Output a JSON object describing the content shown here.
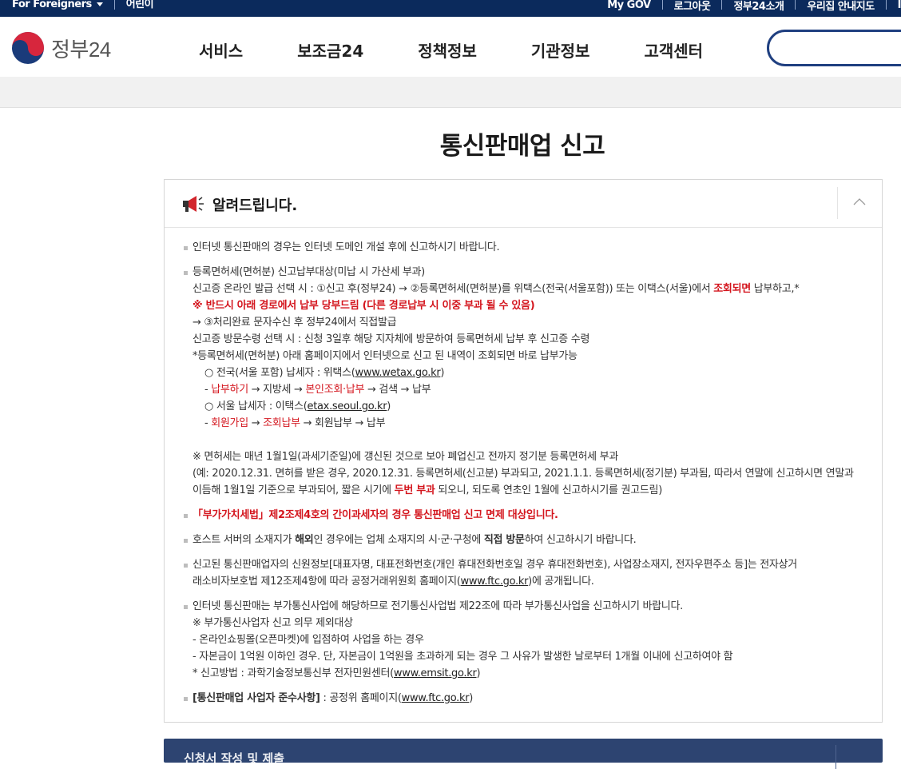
{
  "topbar": {
    "left": [
      "For Foreigners",
      "어린이"
    ],
    "right": [
      "My GOV",
      "로그아웃",
      "정부24소개",
      "우리집 안내지도",
      "I"
    ]
  },
  "header": {
    "logo_text": "정부24",
    "nav": [
      "서비스",
      "보조금24",
      "정책정보",
      "기관정보",
      "고객센터"
    ],
    "search_placeholder": ""
  },
  "page": {
    "title": "통신판매업 신고"
  },
  "notice": {
    "title": "알려드립니다.",
    "items": {
      "i1": "인터넷 통신판매의 경우는 인터넷 도메인 개설 후에 신고하시기 바랍니다.",
      "i2": {
        "l1": "등록면허세(면허분) 신고납부대상(미납 시 가산세 부과)",
        "l2a": "신고증 온라인 발급 선택 시 : ①신고 후(정부24) → ②등록면허세(면허분)를 위택스(전국(서울포함)) 또는 이택스(서울)에서 ",
        "l2b": "조회되면",
        "l2c": " 납부하고,*",
        "l3": "※ 반드시 아래 경로에서 납부 당부드림 (다른 경로납부 시 이중 부과 될 수 있음)",
        "l4": "→ ③처리완료 문자수신 후 정부24에서 직접발급",
        "l5": "신고증 방문수령 선택 시 : 신청 3일후 해당 지자체에 방문하여 등록면허세 납부 후 신고증 수령",
        "l6": "*등록면허세(면허분) 아래 홈페이지에서 인터넷으로 신고 된 내역이 조회되면 바로 납부가능",
        "l7a": "○ 전국(서울 포함) 납세자 : 위택스(",
        "l7b": "www.wetax.go.kr",
        "l7c": ")",
        "l8a": "- ",
        "l8b": "납부하기",
        "l8c": " → 지방세 → ",
        "l8d": "본인조회·납부",
        "l8e": " → 검색 → 납부",
        "l9a": "○ 서울 납세자 : 이택스(",
        "l9b": "etax.seoul.go.kr",
        "l9c": ")",
        "l10a": "- ",
        "l10b": "회원가입",
        "l10c": " → ",
        "l10d": "조회납부",
        "l10e": " → 회원납부 → 납부",
        "l11": "※ 면허세는 매년 1월1일(과세기준일)에 갱신된 것으로 보아 폐업신고 전까지 정기분 등록면허세 부과",
        "l12": "(예: 2020.12.31. 면허를 받은 경우, 2020.12.31. 등록면허세(신고분) 부과되고, 2021.1.1. 등록면허세(정기분) 부과됨, 따라서 연말에 신고하시면 연말과",
        "l13a": "이듬해 1월1일 기준으로 부과되어, 짧은 시기에 ",
        "l13b": "두번 부과",
        "l13c": " 되오니, 되도록 연초인 1월에 신고하시기를 권고드림)"
      },
      "i3": "「부가가치세법」제2조제4호의 간이과세자의 경우 통신판매업 신고 면제 대상입니다.",
      "i4a": "호스트 서버의 소재지가 ",
      "i4b": "해외",
      "i4c": "인 경우에는 업체 소재지의 시·군·구청에 ",
      "i4d": "직접 방문",
      "i4e": "하여 신고하시기 바랍니다.",
      "i5a": "신고된 통신판매업자의 신원정보[대표자명, 대표전화번호(개인 휴대전화번호일 경우 휴대전화번호), 사업장소재지, 전자우편주소 등]는 전자상거",
      "i5b": "래소비자보호법 제12조제4항에 따라 공정거래위원회 홈페이지(",
      "i5c": "www.ftc.go.kr",
      "i5d": ")에 공개됩니다.",
      "i6": {
        "l1": "인터넷 통신판매는 부가통신사업에 해당하므로 전기통신사업법 제22조에 따라 부가통신사업을 신고하시기 바랍니다.",
        "l2": "※ 부가통신사업자 신고 의무 제외대상",
        "l3": "- 온라인쇼핑몰(오픈마켓)에 입점하여 사업을 하는 경우",
        "l4": "- 자본금이 1억원 이하인 경우. 단, 자본금이 1억원을 초과하게 되는 경우 그 사유가 발생한 날로부터 1개월 이내에 신고하여야 함",
        "l5a": "* 신고방법 : 과학기술정보통신부 전자민원센터(",
        "l5b": "www.emsit.go.kr",
        "l5c": ")"
      },
      "i7a": "[통신판매업 사업자 준수사항]",
      "i7b": " : 공정위 홈페이지(",
      "i7c": "www.ftc.go.kr",
      "i7d": ")"
    }
  },
  "bottom_bar": {
    "label": "신청서 작성 및 제출"
  },
  "colors": {
    "topbar": "#0b2a5c",
    "accent_red": "#d4161e",
    "search_border": "#1f3f80",
    "bottom_bar": "#2d4471"
  },
  "icons": [
    "triangle-down-icon",
    "gov-taegeuk-logo-icon",
    "megaphone-icon",
    "chevron-up-icon"
  ]
}
